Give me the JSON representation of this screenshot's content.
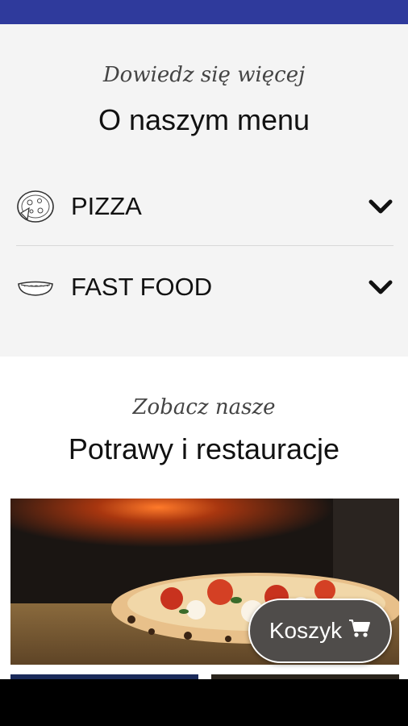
{
  "menu_section": {
    "kicker": "Dowiedz się więcej",
    "title": "O naszym menu",
    "items": [
      {
        "label": "PIZZA",
        "icon": "pizza-icon"
      },
      {
        "label": "FAST FOOD",
        "icon": "hotdog-icon"
      }
    ]
  },
  "restaurants_section": {
    "kicker": "Zobacz nasze",
    "title": "Potrawy i restauracje"
  },
  "cart": {
    "label": "Koszyk",
    "icon": "cart-icon"
  },
  "colors": {
    "status_bar": "#2f3a9c",
    "menu_background": "#f4f4f4",
    "cart_button": "#4f4c4a"
  }
}
